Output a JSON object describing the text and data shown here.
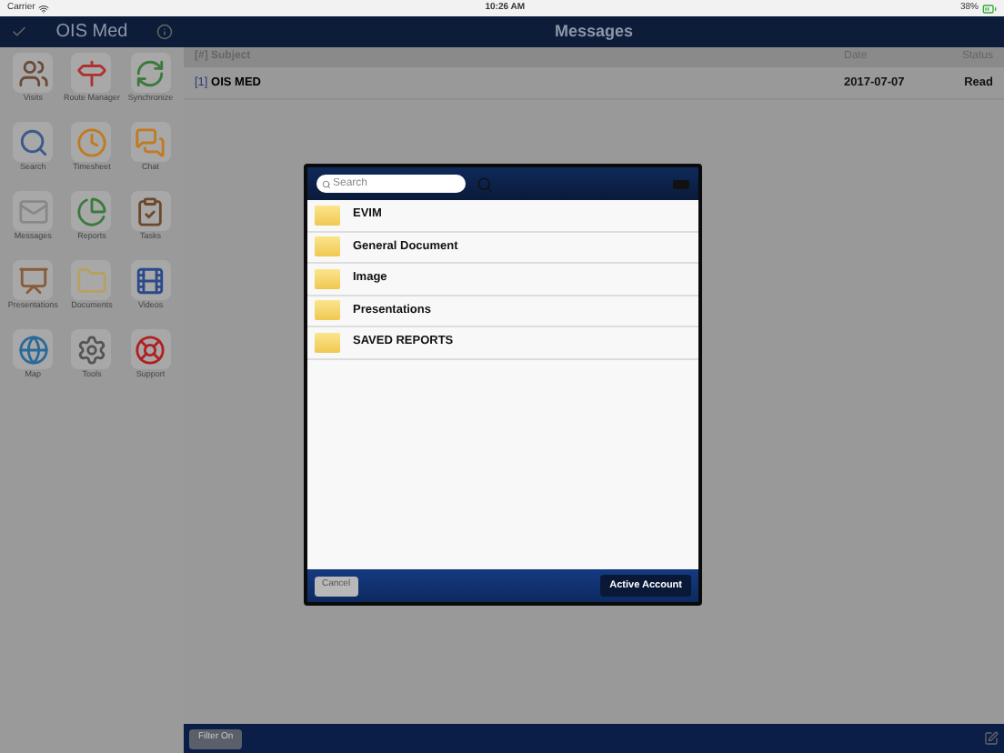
{
  "status_bar": {
    "carrier": "Carrier",
    "time": "10:26 AM",
    "battery": "38%"
  },
  "sidebar": {
    "title": "OIS Med",
    "items": [
      {
        "label": "Visits",
        "kind": "people"
      },
      {
        "label": "Route Manager",
        "kind": "signpost"
      },
      {
        "label": "Synchronize",
        "kind": "sync"
      },
      {
        "label": "Search",
        "kind": "search"
      },
      {
        "label": "Timesheet",
        "kind": "clock"
      },
      {
        "label": "Chat",
        "kind": "chat"
      },
      {
        "label": "Messages",
        "kind": "mail"
      },
      {
        "label": "Reports",
        "kind": "pie"
      },
      {
        "label": "Tasks",
        "kind": "tasks"
      },
      {
        "label": "Presentations",
        "kind": "easel"
      },
      {
        "label": "Documents",
        "kind": "folder"
      },
      {
        "label": "Videos",
        "kind": "film"
      },
      {
        "label": "Map",
        "kind": "globe"
      },
      {
        "label": "Tools",
        "kind": "gear"
      },
      {
        "label": "Support",
        "kind": "help"
      }
    ]
  },
  "main": {
    "title": "Messages",
    "columns": [
      "[#] Subject",
      "Date",
      "Status"
    ],
    "rows": [
      {
        "index": "[1]",
        "subject": "OIS MED",
        "date": "2017-07-07",
        "status": "Read"
      }
    ],
    "toolbar": {
      "filter_button": "Filter On"
    }
  },
  "dialog": {
    "search": {
      "placeholder": "Search"
    },
    "folders": [
      "EVIM",
      "General Document",
      "Image",
      "Presentations",
      "SAVED REPORTS"
    ],
    "cancel": {
      "label": "Cancel",
      "disabled": true
    },
    "confirm": {
      "label": "Active Account"
    }
  }
}
